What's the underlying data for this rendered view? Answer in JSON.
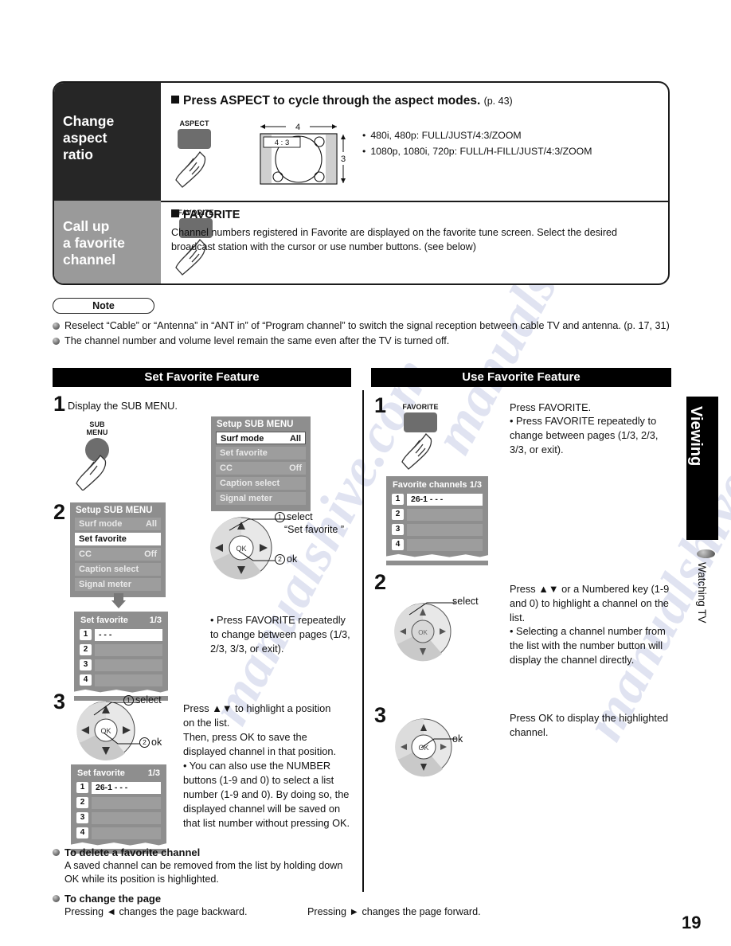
{
  "watermark": {
    "text": "manualshive.com"
  },
  "aspect_section": {
    "label": "Change\naspect\nratio",
    "label_lines": [
      "Change",
      "aspect",
      "ratio"
    ],
    "heading": "Press ASPECT to cycle through the aspect modes.",
    "heading_ref": "(p. 43)",
    "key_label": "ASPECT",
    "diagram": {
      "width_label": "4",
      "height_label": "3",
      "mode_label": "4 : 3"
    },
    "modes": [
      "480i, 480p:  FULL/JUST/4:3/ZOOM",
      "1080p, 1080i, 720p:  FULL/H-FILL/JUST/4:3/ZOOM"
    ]
  },
  "favorite_section": {
    "label_lines": [
      "Call up",
      "a favorite",
      "channel"
    ],
    "key_label": "FAVORITE",
    "heading": "FAVORITE",
    "body": "Channel numbers registered in Favorite are displayed on the favorite tune screen. Select the desired broadcast station with the cursor or use number buttons. (see below)"
  },
  "note": {
    "title": "Note",
    "items": [
      "Reselect “Cable” or “Antenna” in “ANT in” of “Program channel” to switch the signal reception between cable TV and antenna. (p. 17, 31)",
      "The channel number and volume level remain the same even after the TV is turned off."
    ]
  },
  "left_column": {
    "header": "Set Favorite Feature",
    "step1": {
      "num": "1",
      "text": "Display the SUB MENU.",
      "key_label_line1": "SUB",
      "key_label_line2": "MENU",
      "osd": {
        "title": "Setup SUB MENU",
        "rows": [
          {
            "label": "Surf mode",
            "value": "All",
            "style": "box"
          },
          {
            "label": "Set favorite",
            "value": "",
            "style": "plain"
          },
          {
            "label": "CC",
            "value": "Off",
            "style": "plain"
          },
          {
            "label": "Caption select",
            "value": "",
            "style": "plain"
          },
          {
            "label": "Signal meter",
            "value": "",
            "style": "plain"
          }
        ]
      }
    },
    "step2": {
      "num": "2",
      "osd": {
        "title": "Setup SUB MENU",
        "rows": [
          {
            "label": "Surf mode",
            "value": "All",
            "style": "plain"
          },
          {
            "label": "Set favorite",
            "value": "",
            "style": "sel"
          },
          {
            "label": "CC",
            "value": "Off",
            "style": "plain"
          },
          {
            "label": "Caption select",
            "value": "",
            "style": "plain"
          },
          {
            "label": "Signal meter",
            "value": "",
            "style": "plain"
          }
        ]
      },
      "pad_label_select_num": "1",
      "pad_label_select": "select",
      "pad_label_select_sub": "“Set favorite ”",
      "pad_label_ok_num": "2",
      "pad_label_ok": "ok",
      "fav_osd": {
        "title": "Set favorite",
        "page": "1/3",
        "rows": [
          {
            "num": "1",
            "value": "- - -",
            "active": true
          },
          {
            "num": "2",
            "value": "",
            "active": false
          },
          {
            "num": "3",
            "value": "",
            "active": false
          },
          {
            "num": "4",
            "value": "",
            "active": false
          }
        ]
      },
      "note": "• Press FAVORITE repeatedly to change between pages (1/3, 2/3, 3/3, or exit)."
    },
    "step3": {
      "num": "3",
      "pad_label_select_num": "1",
      "pad_label_select": "select",
      "pad_label_ok_num": "2",
      "pad_label_ok": "ok",
      "fav_osd": {
        "title": "Set favorite",
        "page": "1/3",
        "rows": [
          {
            "num": "1",
            "value": "26-1      - - -",
            "active": true
          },
          {
            "num": "2",
            "value": "",
            "active": false
          },
          {
            "num": "3",
            "value": "",
            "active": false
          },
          {
            "num": "4",
            "value": "",
            "active": false
          }
        ]
      },
      "text": "Press ▲▼ to highlight a position on the list.\nThen, press OK to save the displayed channel in that position.",
      "text_line1": "Press ▲▼ to highlight a position",
      "text_line2": "on the list.",
      "text_line3": "Then, press OK to save the",
      "text_line4": "displayed channel in that position.",
      "bullet": "• You can also use the NUMBER buttons (1-9 and 0) to select a list number (1-9 and 0). By doing so, the displayed channel will be saved on that list number without pressing OK."
    }
  },
  "right_column": {
    "header": "Use Favorite Feature",
    "step1": {
      "num": "1",
      "key_label": "FAVORITE",
      "text": "Press FAVORITE.",
      "bullet": "• Press FAVORITE repeatedly to change between pages (1/3, 2/3, 3/3, or exit).",
      "fav_osd": {
        "title": "Favorite channels",
        "page": "1/3",
        "rows": [
          {
            "num": "1",
            "value": "26-1      - - -",
            "active": true
          },
          {
            "num": "2",
            "value": "",
            "active": false
          },
          {
            "num": "3",
            "value": "",
            "active": false
          },
          {
            "num": "4",
            "value": "",
            "active": false
          }
        ]
      }
    },
    "step2": {
      "num": "2",
      "pad_label_select": "select",
      "text": "Press ▲▼ or a Numbered key (1-9 and 0) to highlight a channel on the list.",
      "bullet": "• Selecting a channel number from the list with the number button will display the channel directly."
    },
    "step3": {
      "num": "3",
      "pad_label_ok": "ok",
      "text": "Press OK to display the highlighted channel."
    }
  },
  "bottom": {
    "delete": {
      "heading": "To delete a favorite channel",
      "body": "A saved channel can be removed from the list by holding down OK while its position is highlighted."
    },
    "change_page": {
      "heading": "To change the page",
      "left": "Pressing ◄ changes the page backward.",
      "right": "Pressing ► changes the page forward."
    }
  },
  "side_tab": {
    "label": "Viewing",
    "sub_label": "Watching TV"
  },
  "page_number": "19",
  "osd_pad": {
    "ok_label": "OK"
  }
}
